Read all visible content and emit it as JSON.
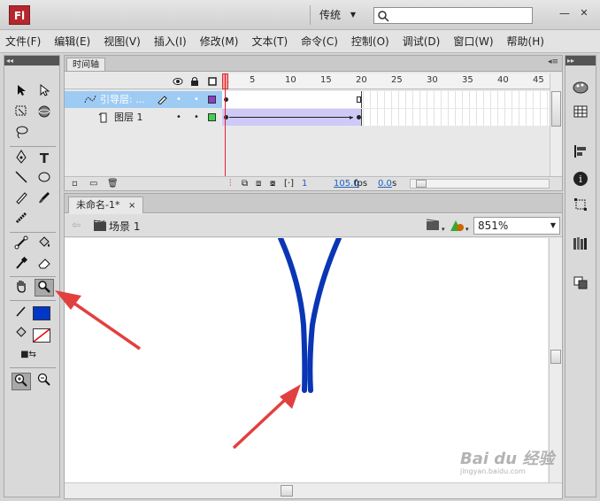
{
  "title_bar": {
    "logo_text": "Fl",
    "workspace": "传统",
    "search_placeholder": "",
    "min_glyph": "—",
    "close_glyph": "✕"
  },
  "menu": [
    "文件(F)",
    "编辑(E)",
    "视图(V)",
    "插入(I)",
    "修改(M)",
    "文本(T)",
    "命令(C)",
    "控制(O)",
    "调试(D)",
    "窗口(W)",
    "帮助(H)"
  ],
  "timeline": {
    "tab_label": "时间轴",
    "frame_numbers": [
      "1",
      "5",
      "10",
      "15",
      "20",
      "25",
      "30",
      "35",
      "40",
      "45"
    ],
    "layers": [
      {
        "name": "引导层: ...",
        "color": "#8a3fc6",
        "selected": true
      },
      {
        "name": "图层 1",
        "color": "#3fd14f",
        "selected": false
      }
    ],
    "footer": {
      "current_frame": "1",
      "fps": "105.0",
      "fps_unit": "fps",
      "time": "0.0",
      "time_unit": "s"
    }
  },
  "document": {
    "tab_label": "未命名-1*",
    "scene_label": "场景 1",
    "zoom": "851%"
  },
  "colors": {
    "stroke_color": "#0037c8",
    "fill_color": "none",
    "stage_stroke": "#0a36b5",
    "arrow_color": "#e2403f"
  },
  "watermark": {
    "main": "Bai du 经验",
    "sub": "jingyan.baidu.com"
  }
}
